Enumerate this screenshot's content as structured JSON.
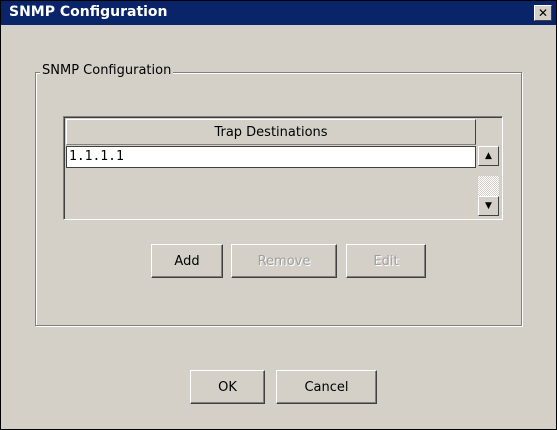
{
  "window": {
    "title": "SNMP Configuration",
    "close_glyph": "✕",
    "close_icon": "close-icon"
  },
  "group": {
    "legend": "SNMP Configuration"
  },
  "trap_list": {
    "column_header": "Trap Destinations",
    "rows": [
      "1.1.1.1"
    ],
    "scroll_up_icon": "scroll-up-arrow-icon",
    "scroll_down_icon": "scroll-down-arrow-icon",
    "scroll_up_glyph": "▲",
    "scroll_down_glyph": "▼"
  },
  "list_buttons": {
    "add": "Add",
    "remove": "Remove",
    "edit": "Edit"
  },
  "dialog_buttons": {
    "ok": "OK",
    "cancel": "Cancel"
  },
  "colors": {
    "titlebar": "#0a246a",
    "face": "#d4d0c8",
    "disabled_text": "#a0a0a0"
  }
}
